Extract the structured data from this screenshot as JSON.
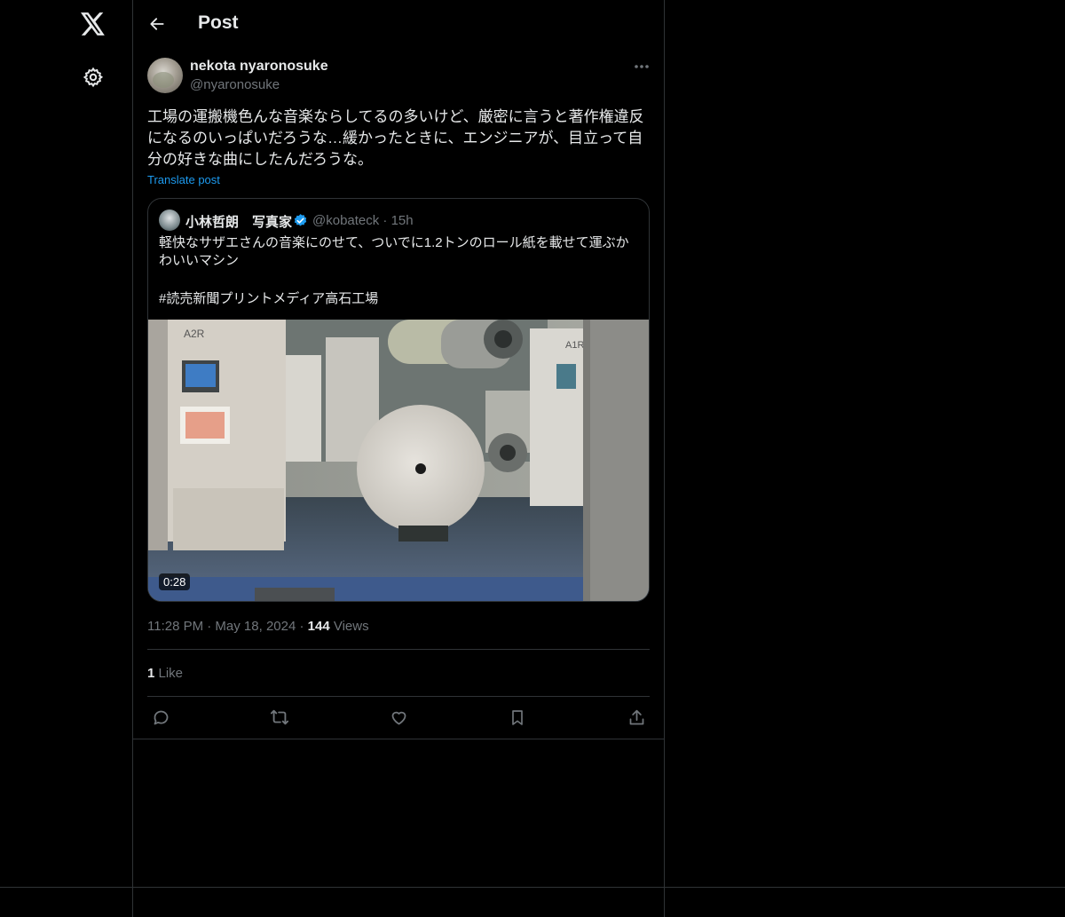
{
  "header": {
    "title": "Post",
    "back_icon": "arrow-left-icon"
  },
  "nav": {
    "logo_icon": "x-logo-icon",
    "settings_icon": "gear-icon"
  },
  "post": {
    "author": {
      "name": "nekota nyaronosuke",
      "handle": "@nyaronosuke"
    },
    "text": "工場の運搬機色んな音楽ならしてるの多いけど、厳密に言うと著作権違反になるのいっぱいだろうな…緩かったときに、エンジニアが、目立って自分の好きな曲にしたんだろうな。",
    "translate_label": "Translate post",
    "timestamp": "11:28 PM · May 18, 2024 · ",
    "views_count": "144",
    "views_label": " Views",
    "likes_count": "1",
    "likes_label": " Like"
  },
  "quote": {
    "author_name": "小林哲朗　写真家",
    "handle_time": "@kobateck · 15h",
    "text": "軽快なサザエさんの音楽にのせて、ついでに1.2トンのロール紙を載せて運ぶかわいいマシン",
    "hashtag": "#読売新聞プリントメディア高石工場",
    "video_duration": "0:28"
  },
  "actions": [
    "reply-icon",
    "repost-icon",
    "like-icon",
    "bookmark-icon",
    "share-icon"
  ],
  "colors": {
    "accent": "#1d9bf0",
    "background": "#000000",
    "muted": "#71767b",
    "border": "#2f3336"
  }
}
